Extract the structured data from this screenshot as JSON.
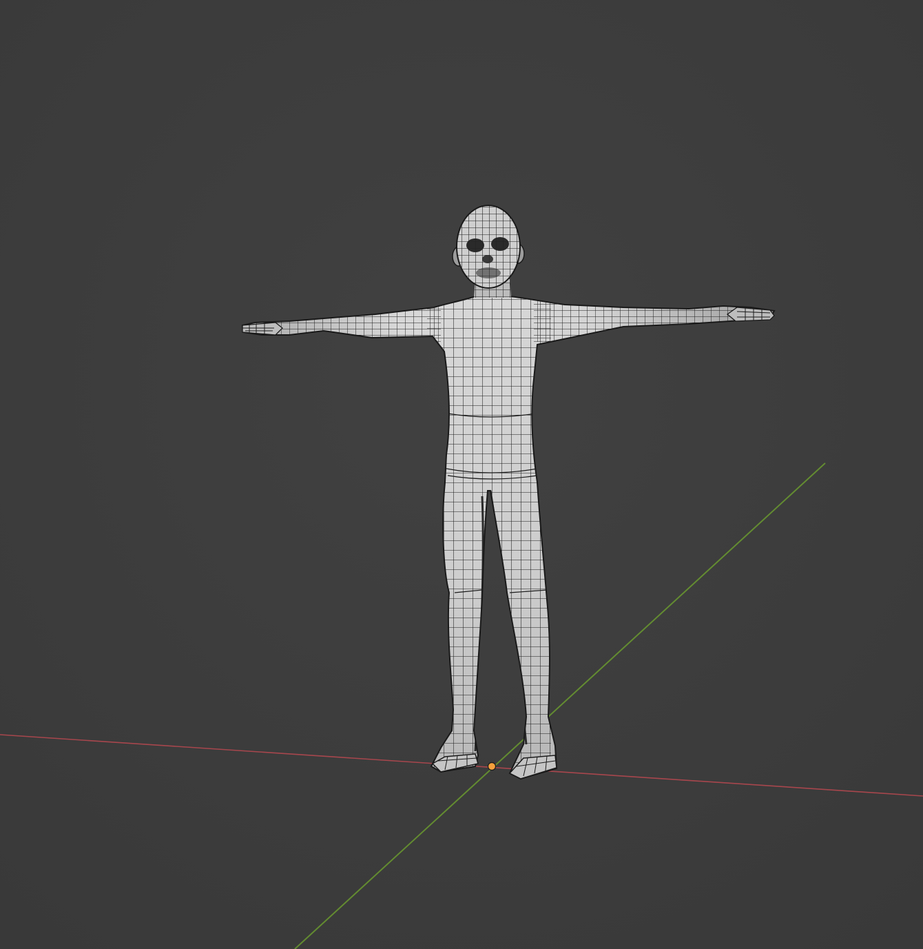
{
  "viewport": {
    "background": "#3d3d3d",
    "axes": {
      "x_axis_color": "#b4484f",
      "y_axis_color": "#6a9a2f"
    },
    "origin_marker": {
      "icon": "origin-dot-icon",
      "color": "#f5a03c"
    },
    "mesh": {
      "object": "character-mesh",
      "pose": "T-pose",
      "display": "wireframe-on-shaded",
      "surface_color": "#cfcfcf",
      "wire_color": "#1b1b1b"
    }
  }
}
